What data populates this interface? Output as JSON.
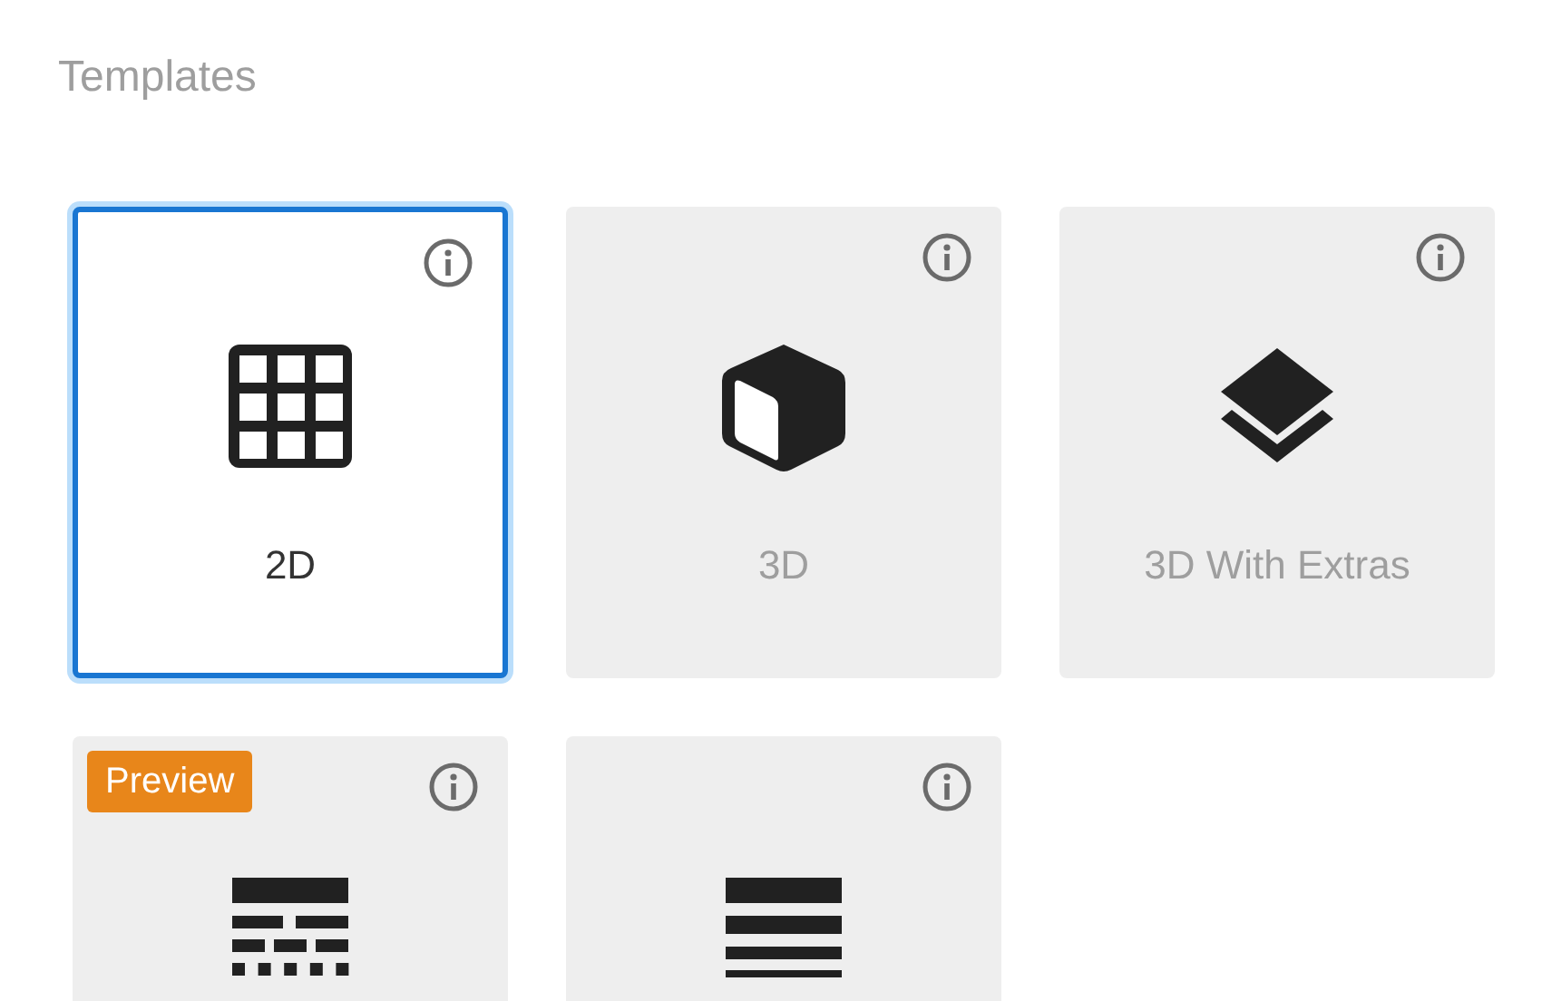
{
  "title": "Templates",
  "templates": [
    {
      "kind": "grid",
      "label": "2D",
      "selected": true
    },
    {
      "kind": "cube",
      "label": "3D",
      "selected": false
    },
    {
      "kind": "layers",
      "label": "3D With Extras",
      "selected": false
    },
    {
      "kind": "dashes",
      "badge": "Preview",
      "selected": false
    },
    {
      "kind": "lines",
      "selected": false
    }
  ]
}
